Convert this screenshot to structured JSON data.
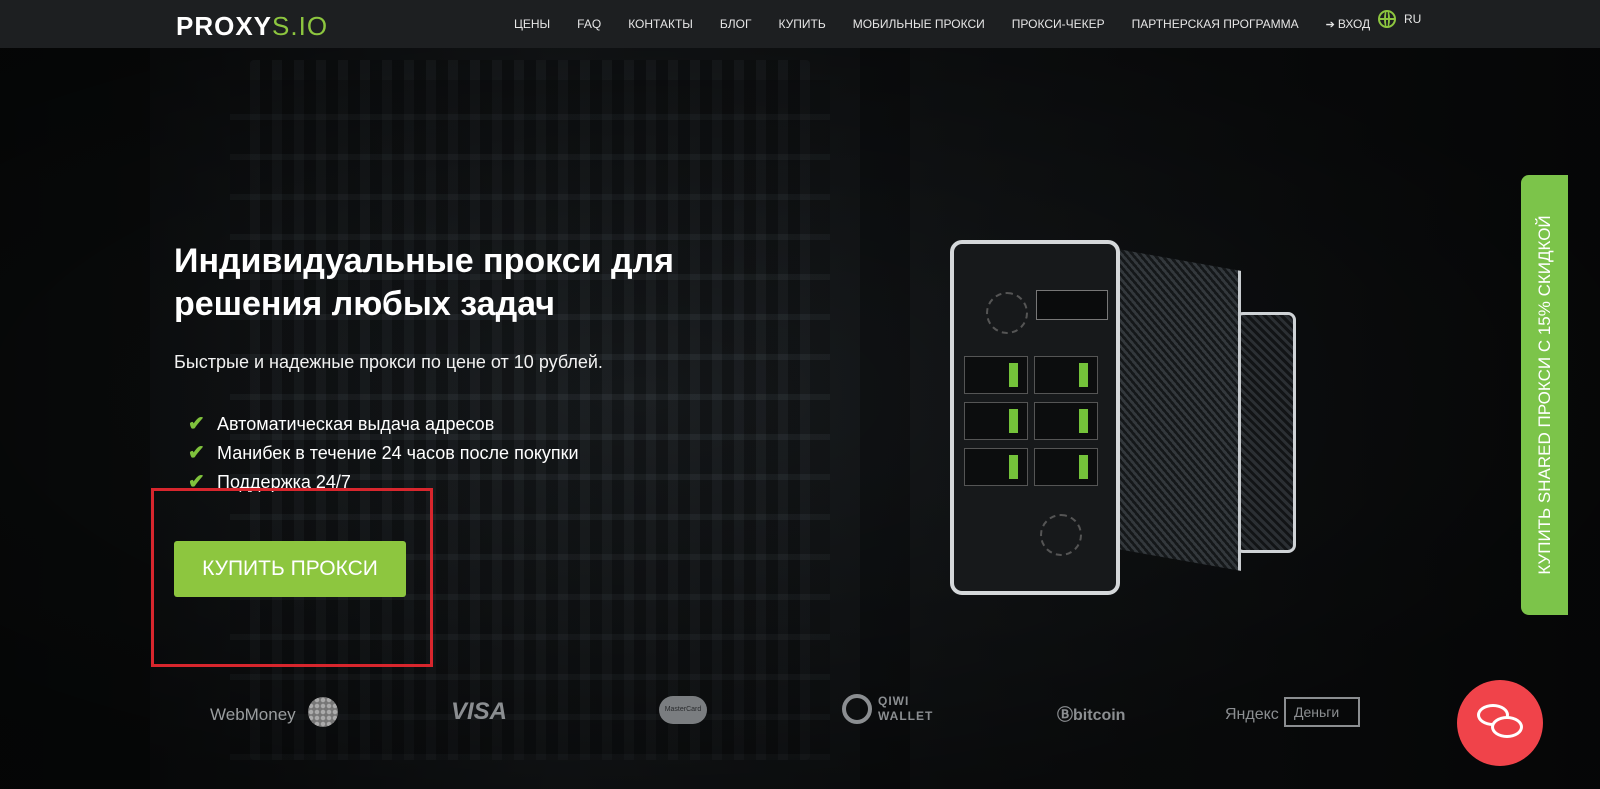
{
  "brand": {
    "logo_main": "PROXY",
    "logo_accent": "S.IO"
  },
  "nav": {
    "items": [
      "ЦЕНЫ",
      "FAQ",
      "КОНТАКТЫ",
      "БЛОГ",
      "КУПИТЬ",
      "МОБИЛЬНЫЕ ПРОКСИ",
      "ПРОКСИ-ЧЕКЕР",
      "ПАРТНЕРСКАЯ ПРОГРАММА"
    ],
    "login": "ВХОД",
    "lang": "RU"
  },
  "hero": {
    "title": "Индивидуальные прокси для решения любых задач",
    "subtitle": "Быстрые и надежные прокси по цене от 10 рублей.",
    "features": [
      "Автоматическая выдача адресов",
      "Манибек в течение 24 часов после покупки",
      "Поддержка 24/7"
    ],
    "cta": "КУПИТЬ ПРОКСИ"
  },
  "side_tab": "КУПИТЬ SHARED ПРОКСИ С 15% СКИДКОЙ",
  "payments": {
    "webmoney": "WebMoney",
    "visa": "VISA",
    "mastercard": "MasterCard",
    "qiwi_line1": "QIWI",
    "qiwi_line2": "WALLET",
    "bitcoin": "bitcoin",
    "yandex": "Яндекс",
    "yandex_box": "Деньги"
  },
  "icons": {
    "login": "login-arrow-icon",
    "lang": "globe-icon",
    "check": "check-icon",
    "chat": "chat-bubbles-icon"
  },
  "colors": {
    "accent": "#8dc63f",
    "highlight": "#d8262d",
    "chat": "#f0434a",
    "nav_bg": "#1d1f21"
  }
}
